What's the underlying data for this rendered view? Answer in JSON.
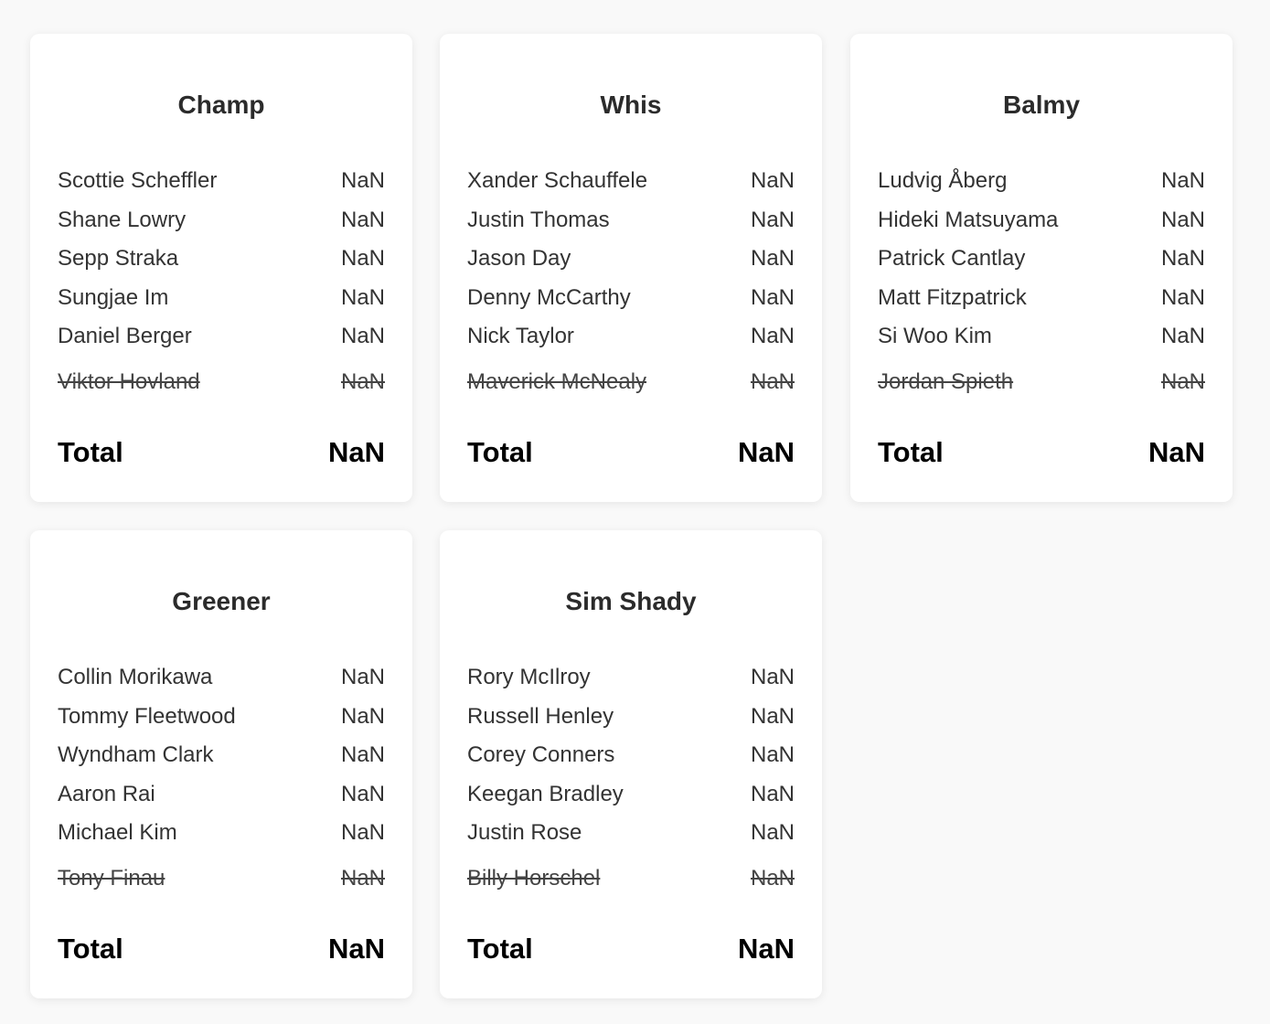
{
  "teams": [
    {
      "name": "Champ",
      "players": [
        {
          "name": "Scottie Scheffler",
          "score": "NaN"
        },
        {
          "name": "Shane Lowry",
          "score": "NaN"
        },
        {
          "name": "Sepp Straka",
          "score": "NaN"
        },
        {
          "name": "Sungjae Im",
          "score": "NaN"
        },
        {
          "name": "Daniel Berger",
          "score": "NaN"
        }
      ],
      "cut_player": {
        "name": "Viktor Hovland",
        "score": "NaN"
      },
      "total_label": "Total",
      "total_value": "NaN"
    },
    {
      "name": "Whis",
      "players": [
        {
          "name": "Xander Schauffele",
          "score": "NaN"
        },
        {
          "name": "Justin Thomas",
          "score": "NaN"
        },
        {
          "name": "Jason Day",
          "score": "NaN"
        },
        {
          "name": "Denny McCarthy",
          "score": "NaN"
        },
        {
          "name": "Nick Taylor",
          "score": "NaN"
        }
      ],
      "cut_player": {
        "name": "Maverick McNealy",
        "score": "NaN"
      },
      "total_label": "Total",
      "total_value": "NaN"
    },
    {
      "name": "Balmy",
      "players": [
        {
          "name": "Ludvig Åberg",
          "score": "NaN"
        },
        {
          "name": "Hideki Matsuyama",
          "score": "NaN"
        },
        {
          "name": "Patrick Cantlay",
          "score": "NaN"
        },
        {
          "name": "Matt Fitzpatrick",
          "score": "NaN"
        },
        {
          "name": "Si Woo Kim",
          "score": "NaN"
        }
      ],
      "cut_player": {
        "name": "Jordan Spieth",
        "score": "NaN"
      },
      "total_label": "Total",
      "total_value": "NaN"
    },
    {
      "name": "Greener",
      "players": [
        {
          "name": "Collin Morikawa",
          "score": "NaN"
        },
        {
          "name": "Tommy Fleetwood",
          "score": "NaN"
        },
        {
          "name": "Wyndham Clark",
          "score": "NaN"
        },
        {
          "name": "Aaron Rai",
          "score": "NaN"
        },
        {
          "name": "Michael Kim",
          "score": "NaN"
        }
      ],
      "cut_player": {
        "name": "Tony Finau",
        "score": "NaN"
      },
      "total_label": "Total",
      "total_value": "NaN"
    },
    {
      "name": "Sim Shady",
      "players": [
        {
          "name": "Rory McIlroy",
          "score": "NaN"
        },
        {
          "name": "Russell Henley",
          "score": "NaN"
        },
        {
          "name": "Corey Conners",
          "score": "NaN"
        },
        {
          "name": "Keegan Bradley",
          "score": "NaN"
        },
        {
          "name": "Justin Rose",
          "score": "NaN"
        }
      ],
      "cut_player": {
        "name": "Billy Horschel",
        "score": "NaN"
      },
      "total_label": "Total",
      "total_value": "NaN"
    }
  ]
}
